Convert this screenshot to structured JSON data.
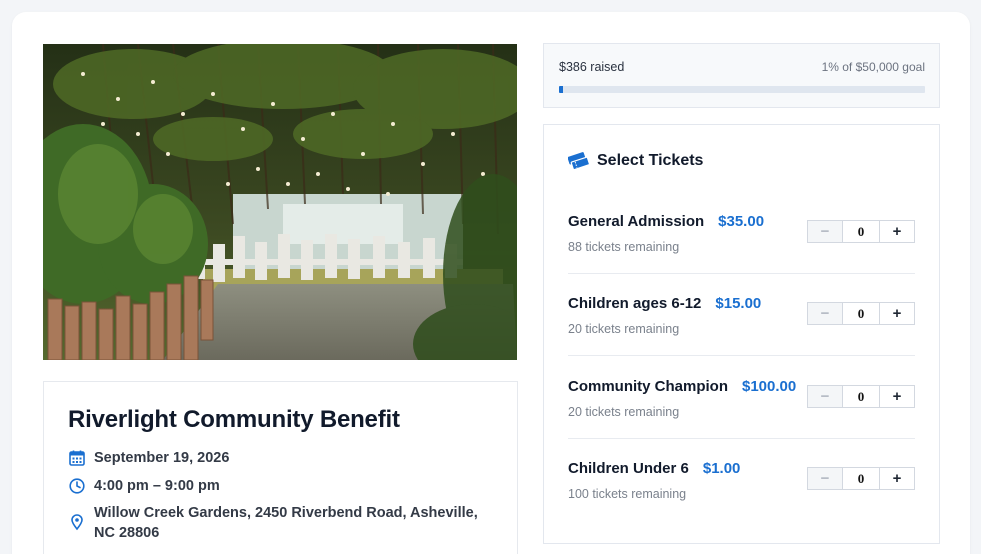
{
  "event": {
    "title": "Riverlight Community Benefit",
    "date": "September 19, 2026",
    "time": "4:00 pm – 9:00 pm",
    "location": "Willow Creek Gardens, 2450 Riverbend Road, Asheville, NC 28806",
    "icons": {
      "date": "calendar-icon",
      "time": "clock-icon",
      "location": "map-pin-icon"
    }
  },
  "fundraising": {
    "raised_label": "$386 raised",
    "goal_label": "1% of $50,000 goal",
    "progress_fraction": 0.01
  },
  "tickets": {
    "heading": "Select Tickets",
    "heading_icon": "tickets-icon",
    "items": [
      {
        "name": "General Admission",
        "price": "$35.00",
        "remaining": "88 tickets remaining",
        "qty": "0"
      },
      {
        "name": "Children ages 6-12",
        "price": "$15.00",
        "remaining": "20 tickets remaining",
        "qty": "0"
      },
      {
        "name": "Community Champion",
        "price": "$100.00",
        "remaining": "20 tickets remaining",
        "qty": "0"
      },
      {
        "name": "Children Under 6",
        "price": "$1.00",
        "remaining": "100 tickets remaining",
        "qty": "0"
      }
    ],
    "minus_label": "−",
    "plus_label": "+"
  },
  "colors": {
    "accent": "#1a6fd0",
    "title": "#111a2b",
    "muted": "#7a818c"
  }
}
